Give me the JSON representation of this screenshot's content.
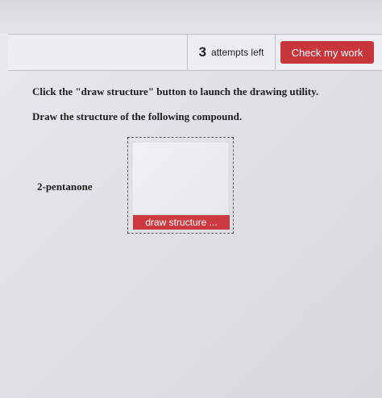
{
  "header": {
    "attempts_count": "3",
    "attempts_label": "attempts left",
    "check_button_label": "Check my work"
  },
  "question": {
    "instruction_1": "Click the \"draw structure\" button to launch the drawing utility.",
    "instruction_2": "Draw the structure of the following compound.",
    "compound": "2-pentanone",
    "draw_button_label": "draw structure ..."
  },
  "colors": {
    "accent": "#c8363c",
    "background": "#e3e4e8"
  }
}
